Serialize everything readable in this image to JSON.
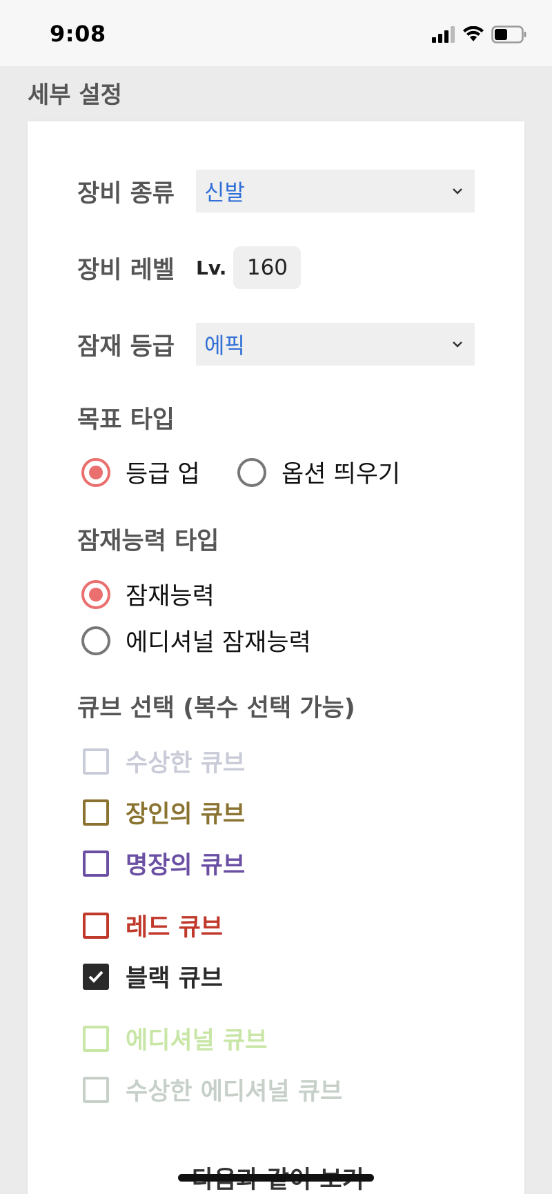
{
  "status_bar": {
    "time": "9:08"
  },
  "section_title": "세부 설정",
  "equipment_type": {
    "label": "장비 종류",
    "value": "신발"
  },
  "equipment_level": {
    "label": "장비 레벨",
    "prefix": "Lv.",
    "value": "160"
  },
  "potential_grade": {
    "label": "잠재 등급",
    "value": "에픽"
  },
  "goal_type": {
    "title": "목표 타입",
    "options": [
      {
        "label": "등급 업",
        "selected": true
      },
      {
        "label": "옵션 띄우기",
        "selected": false
      }
    ]
  },
  "potential_type": {
    "title": "잠재능력 타입",
    "options": [
      {
        "label": "잠재능력",
        "selected": true
      },
      {
        "label": "에디셔널 잠재능력",
        "selected": false
      }
    ]
  },
  "cube_select": {
    "title": "큐브 선택 (복수 선택 가능)",
    "cubes": [
      {
        "label": "수상한 큐브",
        "checked": false,
        "color": "#c9ccd8"
      },
      {
        "label": "장인의 큐브",
        "checked": false,
        "color": "#8a7330"
      },
      {
        "label": "명장의 큐브",
        "checked": false,
        "color": "#6a4fa3"
      },
      {
        "label": "레드 큐브",
        "checked": false,
        "color": "#c0392b"
      },
      {
        "label": "블랙 큐브",
        "checked": true,
        "color": "#2a2a2a"
      },
      {
        "label": "에디셔널 큐브",
        "checked": false,
        "color": "#c8e6a6"
      },
      {
        "label": "수상한 에디셔널 큐브",
        "checked": false,
        "color": "#c6d0c8"
      }
    ]
  },
  "bottom_link": "다음과 같이 보기",
  "colors": {
    "accent": "#ea6f6f",
    "select_text": "#2f6fd6"
  }
}
